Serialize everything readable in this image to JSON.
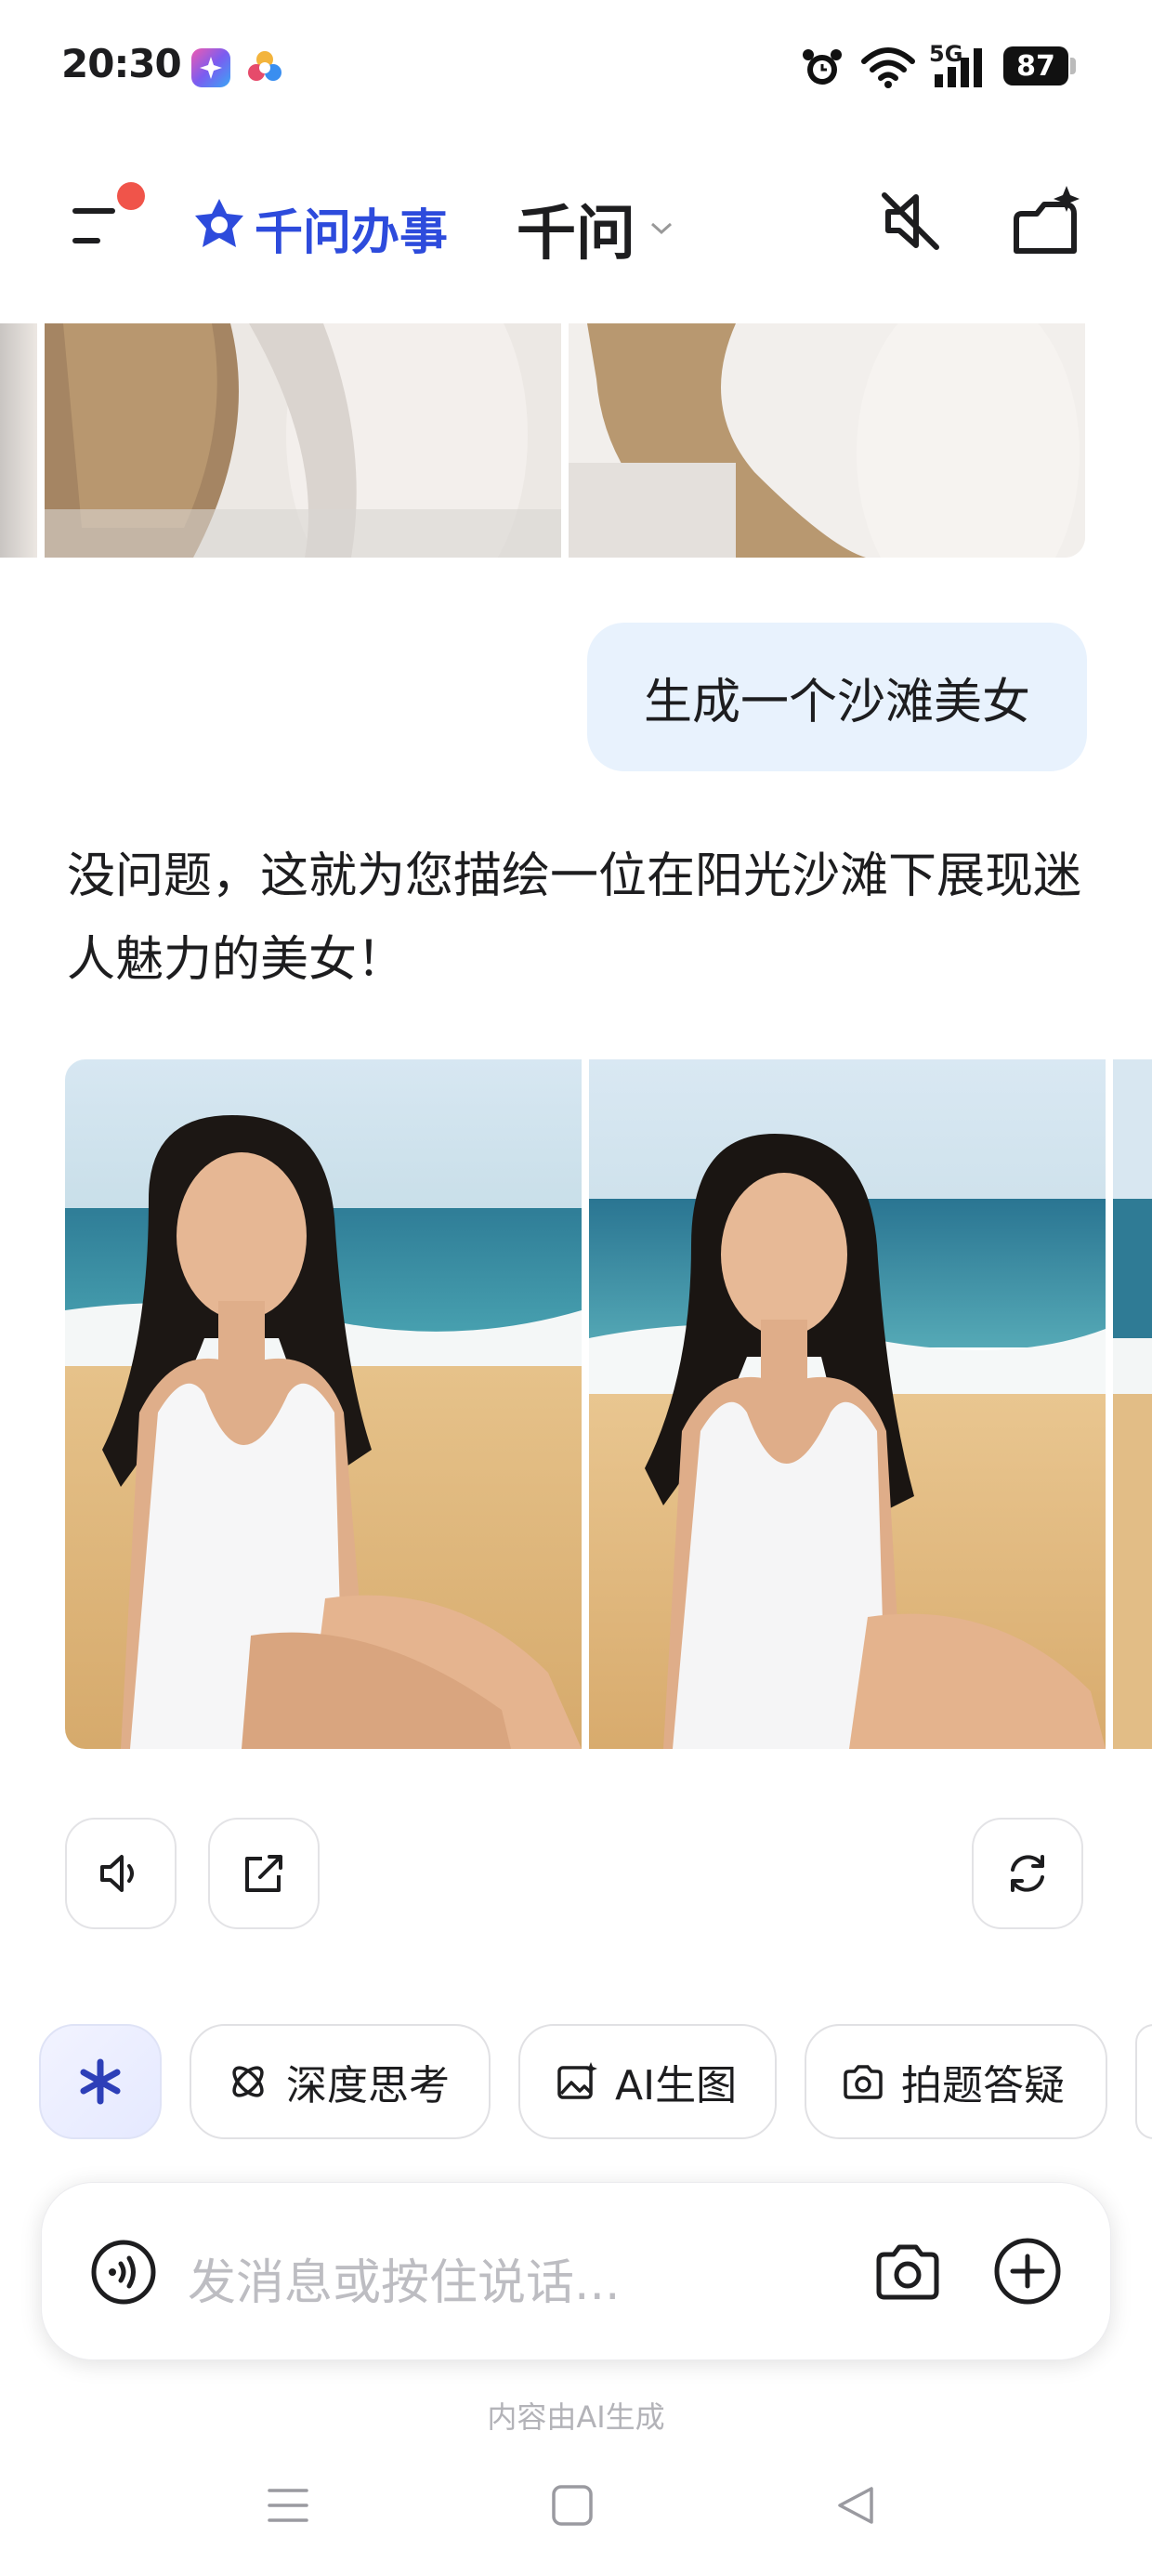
{
  "status_bar": {
    "time": "20:30",
    "network": "5G",
    "battery": "87",
    "icons": [
      "app-store-icon",
      "colorful-app-icon",
      "alarm-icon",
      "wifi-icon",
      "signal-icon",
      "battery-icon"
    ]
  },
  "header": {
    "brand": "千问办事",
    "title": "千问",
    "icons": [
      "menu-icon",
      "brand-logo-icon",
      "chevron-down-icon",
      "mute-icon",
      "new-chat-icon"
    ]
  },
  "chat": {
    "user_message": "生成一个沙滩美女",
    "assistant_reply": "没问题，这就为您描绘一位在阳光沙滩下展现迷人魅力的美女！",
    "image_count_visible": 3
  },
  "actions": {
    "icons": [
      "speaker-icon",
      "share-icon",
      "refresh-icon"
    ]
  },
  "chips": [
    {
      "label": "",
      "icon": "asterisk-icon"
    },
    {
      "label": "深度思考",
      "icon": "think-icon"
    },
    {
      "label": "AI生图",
      "icon": "image-gen-icon"
    },
    {
      "label": "拍题答疑",
      "icon": "camera-question-icon"
    }
  ],
  "input": {
    "placeholder": "发消息或按住说话...",
    "icons": [
      "voice-icon",
      "camera-icon",
      "plus-icon"
    ]
  },
  "footer_note": "内容由AI生成",
  "nav_icons": [
    "menu-nav-icon",
    "home-nav-icon",
    "back-nav-icon"
  ],
  "colors": {
    "brand": "#2d4bdc",
    "bubble": "#e8f2fd",
    "notification_dot": "#f0544a"
  }
}
